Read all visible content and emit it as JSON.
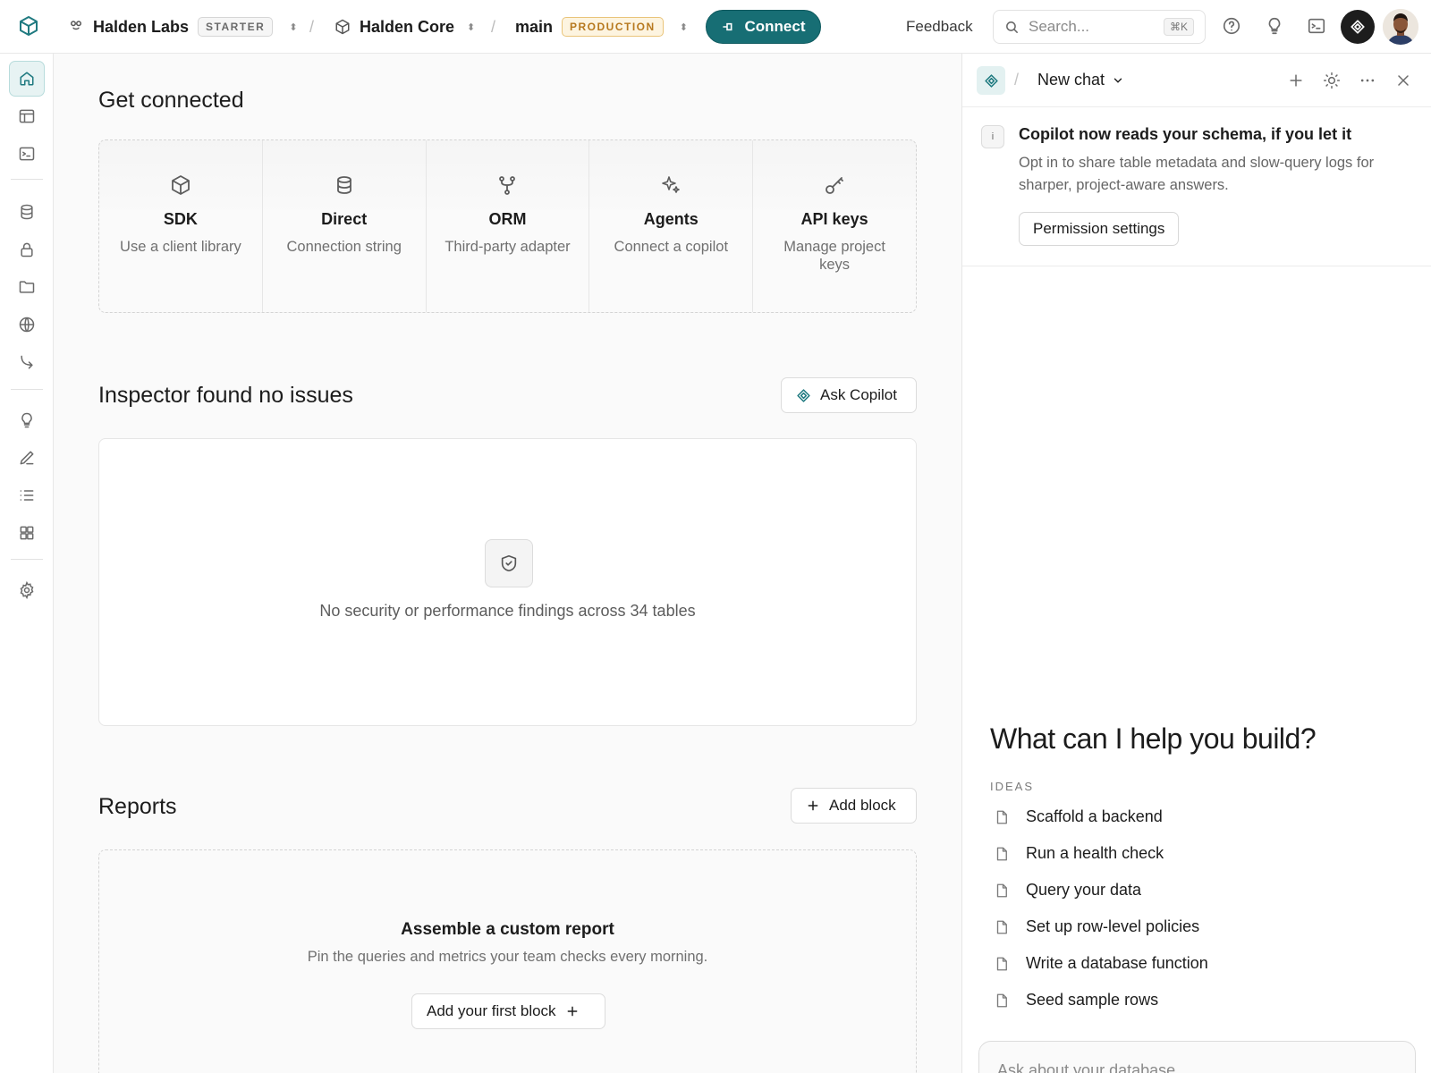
{
  "topbar": {
    "org_name": "Halden Labs",
    "org_plan": "STARTER",
    "project_name": "Halden Core",
    "branch_name": "main",
    "branch_env": "PRODUCTION",
    "connect_label": "Connect",
    "feedback_label": "Feedback",
    "search_placeholder": "Search...",
    "search_shortcut": "⌘K"
  },
  "sidebar": {
    "items": [
      {
        "icon": "home-icon",
        "active": true
      },
      {
        "icon": "table-editor-icon"
      },
      {
        "icon": "sql-editor-icon"
      },
      {
        "icon": "database-icon"
      },
      {
        "icon": "lock-icon"
      },
      {
        "icon": "folder-icon"
      },
      {
        "icon": "globe-icon"
      },
      {
        "icon": "function-arrow-icon"
      },
      {
        "icon": "lightbulb-icon"
      },
      {
        "icon": "pen-icon"
      },
      {
        "icon": "list-icon"
      },
      {
        "icon": "grid-icon"
      },
      {
        "icon": "gear-icon"
      }
    ]
  },
  "main": {
    "connect_heading": "Get connected",
    "connect_options": [
      {
        "title": "SDK",
        "subtitle": "Use a client library",
        "icon": "cube-icon"
      },
      {
        "title": "Direct",
        "subtitle": "Connection string",
        "icon": "database-icon"
      },
      {
        "title": "ORM",
        "subtitle": "Third-party adapter",
        "icon": "branch-icon"
      },
      {
        "title": "Agents",
        "subtitle": "Connect a copilot",
        "icon": "sparkle-icon"
      },
      {
        "title": "API keys",
        "subtitle": "Manage project keys",
        "icon": "key-icon"
      }
    ],
    "inspector_heading": "Inspector found no issues",
    "ask_copilot_label": "Ask Copilot",
    "inspector_message": "No security or performance findings across 34 tables",
    "reports_heading": "Reports",
    "add_block_label": "Add block",
    "report_title": "Assemble a custom report",
    "report_subtitle": "Pin the queries and metrics your team checks every morning.",
    "add_first_block_label": "Add your first block"
  },
  "panel": {
    "chat_title": "New chat",
    "notice_title": "Copilot now reads your schema, if you let it",
    "notice_body": "Opt in to share table metadata and slow-query logs for sharper, project-aware answers.",
    "permission_label": "Permission settings",
    "help_title": "What can I help you build?",
    "ideas_label": "IDEAS",
    "ideas": [
      "Scaffold a backend",
      "Run a health check",
      "Query your data",
      "Set up row-level policies",
      "Write a database function",
      "Seed sample rows"
    ],
    "input_placeholder": "Ask about your database"
  },
  "colors": {
    "accent": "#176e74",
    "production_badge": "#b7791f"
  }
}
